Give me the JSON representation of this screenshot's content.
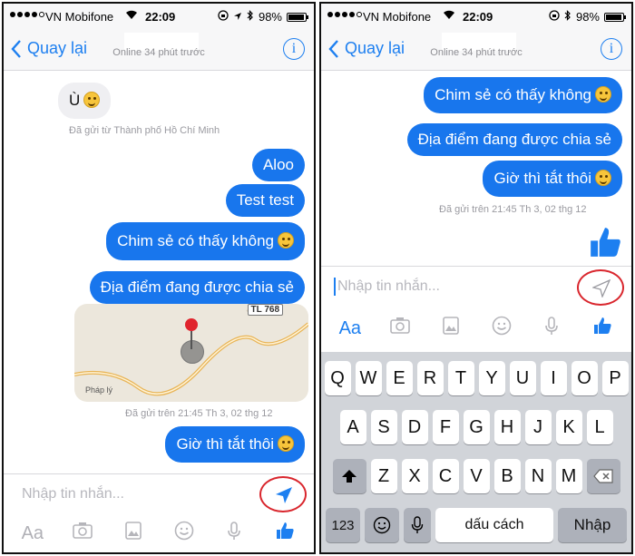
{
  "status": {
    "carrier": "VN Mobifone",
    "time": "22:09",
    "battery": "98%",
    "battery_level": 98
  },
  "nav": {
    "back_label": "Quay lại",
    "subtitle": "Online 34 phút trước",
    "info_label": "i"
  },
  "left": {
    "incoming_message": "Ù",
    "incoming_location_note": "Đã gửi từ Thành phố Hồ Chí Minh",
    "messages": [
      "Aloo",
      "Test test",
      "Chim sẻ có thấy không",
      "Địa điểm đang được chia sẻ"
    ],
    "map": {
      "road": "TL 768",
      "place": "Pháp lý"
    },
    "sent_meta": "Đã gửi trên 21:45 Th 3, 02 thg 12",
    "last_message": "Giờ thì tắt thôi",
    "input_placeholder": "Nhập tin nhắn..."
  },
  "right": {
    "messages": [
      "Chim sẻ có thấy không",
      "Địa điểm đang được chia sẻ",
      "Giờ thì tắt thôi"
    ],
    "sent_meta": "Đã gửi trên 21:45 Th 3, 02 thg 12",
    "input_placeholder": "Nhập tin nhắn..."
  },
  "toolbar": {
    "text_label": "Aa"
  },
  "keyboard": {
    "row1": [
      "Q",
      "W",
      "E",
      "R",
      "T",
      "Y",
      "U",
      "I",
      "O",
      "P"
    ],
    "row2": [
      "A",
      "S",
      "D",
      "F",
      "G",
      "H",
      "J",
      "K",
      "L"
    ],
    "row3": [
      "Z",
      "X",
      "C",
      "V",
      "B",
      "N",
      "M"
    ],
    "num_label": "123",
    "space_label": "dấu cách",
    "return_label": "Nhập"
  },
  "colors": {
    "bubble_blue": "#1876ed",
    "accent": "#1d7ff0",
    "highlight_circle": "#d9262d"
  },
  "icons": [
    "back-chevron-icon",
    "info-icon",
    "send-icon",
    "camera-icon",
    "gallery-icon",
    "emoji-icon",
    "microphone-icon",
    "thumbs-up-icon",
    "shift-icon",
    "backspace-icon",
    "globe-emoji-icon"
  ]
}
